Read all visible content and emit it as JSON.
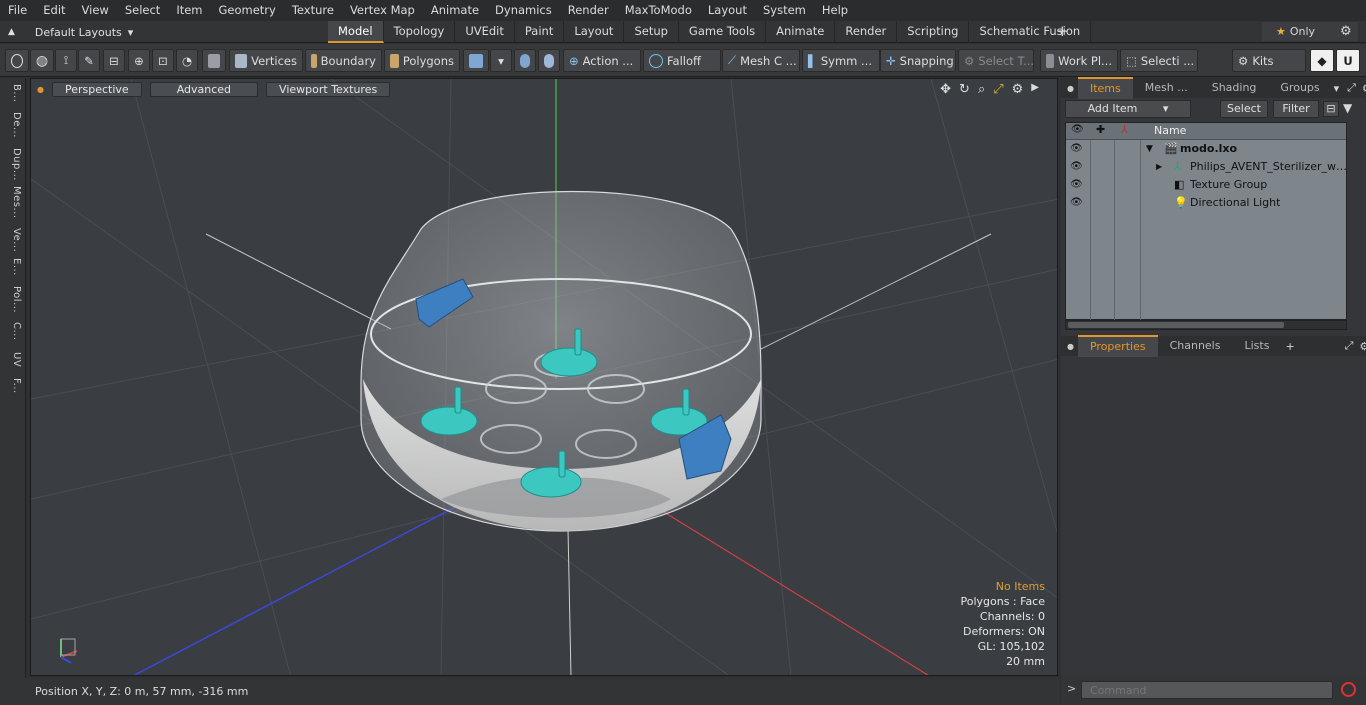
{
  "menu": [
    "File",
    "Edit",
    "View",
    "Select",
    "Item",
    "Geometry",
    "Texture",
    "Vertex Map",
    "Animate",
    "Dynamics",
    "Render",
    "MaxToModo",
    "Layout",
    "System",
    "Help"
  ],
  "layouts": {
    "label": "Default Layouts",
    "caret": "▾"
  },
  "tabs": [
    "Model",
    "Topology",
    "UVEdit",
    "Paint",
    "Layout",
    "Setup",
    "Game Tools",
    "Animate",
    "Render",
    "Scripting",
    "Schematic Fusion"
  ],
  "active_tab": "Model",
  "only_label": "Only",
  "toolbar": {
    "vertices": "Vertices",
    "boundary": "Boundary",
    "polygons": "Polygons",
    "action": "Action ...",
    "falloff": "Falloff",
    "mesh": "Mesh C ...",
    "symm": "Symm ...",
    "snapping": "Snapping",
    "select_t": "Select T...",
    "work_pl": "Work Pl...",
    "selecti": "Selecti ...",
    "kits": "Kits"
  },
  "left_strip": [
    "B...",
    "De...",
    "Dup...",
    "Mes...",
    "Ve...",
    "E...",
    "Pol...",
    "C...",
    "UV",
    "F..."
  ],
  "viewport": {
    "perspective": "Perspective",
    "advanced": "Advanced",
    "viewport_textures": "Viewport Textures",
    "hud": {
      "title": "No Items",
      "polygons": "Polygons : Face",
      "channels": "Channels: 0",
      "deformers": "Deformers: ON",
      "gl": "GL: 105,102",
      "unit": "20 mm"
    }
  },
  "status": {
    "position": "Position X, Y, Z:   0 m, 57 mm, -316 mm"
  },
  "items_panel": {
    "tabs": [
      "Items",
      "Mesh ...",
      "Shading",
      "Groups"
    ],
    "add_item": "Add Item",
    "select": "Select",
    "filter": "Filter",
    "name_header": "Name",
    "rows": [
      {
        "label": "modo.lxo"
      },
      {
        "label": "Philips_AVENT_Sterilizer_with ..."
      },
      {
        "label": "Texture Group"
      },
      {
        "label": "Directional Light"
      }
    ]
  },
  "props_panel": {
    "tabs": [
      "Properties",
      "Channels",
      "Lists"
    ]
  },
  "command": {
    "placeholder": "Command"
  },
  "colors": {
    "accent": "#e0962e",
    "teal": "#3cc7c1",
    "blue_clip": "#3d7fc0"
  }
}
